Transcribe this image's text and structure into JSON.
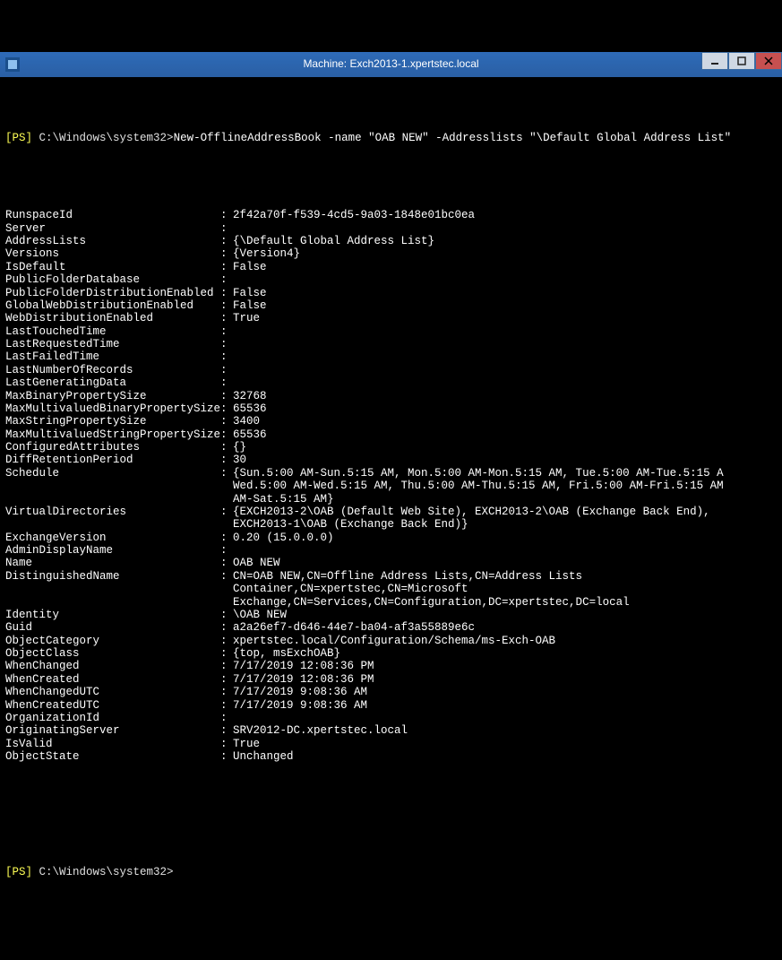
{
  "window": {
    "title": "Machine: Exch2013-1.xpertstec.local"
  },
  "prompt1": {
    "ps": "[PS]",
    "path": "C:\\Windows\\system32>",
    "command": "New-OfflineAddressBook -name \"OAB NEW\" -Addresslists \"\\Default Global Address List\""
  },
  "output": [
    {
      "k": "RunspaceId",
      "v": "2f42a70f-f539-4cd5-9a03-1848e01bc0ea"
    },
    {
      "k": "Server",
      "v": ""
    },
    {
      "k": "AddressLists",
      "v": "{\\Default Global Address List}"
    },
    {
      "k": "Versions",
      "v": "{Version4}"
    },
    {
      "k": "IsDefault",
      "v": "False"
    },
    {
      "k": "PublicFolderDatabase",
      "v": ""
    },
    {
      "k": "PublicFolderDistributionEnabled",
      "v": "False"
    },
    {
      "k": "GlobalWebDistributionEnabled",
      "v": "False"
    },
    {
      "k": "WebDistributionEnabled",
      "v": "True"
    },
    {
      "k": "LastTouchedTime",
      "v": ""
    },
    {
      "k": "LastRequestedTime",
      "v": ""
    },
    {
      "k": "LastFailedTime",
      "v": ""
    },
    {
      "k": "LastNumberOfRecords",
      "v": ""
    },
    {
      "k": "LastGeneratingData",
      "v": ""
    },
    {
      "k": "MaxBinaryPropertySize",
      "v": "32768"
    },
    {
      "k": "MaxMultivaluedBinaryPropertySize",
      "v": "65536"
    },
    {
      "k": "MaxStringPropertySize",
      "v": "3400"
    },
    {
      "k": "MaxMultivaluedStringPropertySize",
      "v": "65536"
    },
    {
      "k": "ConfiguredAttributes",
      "v": "{}"
    },
    {
      "k": "DiffRetentionPeriod",
      "v": "30"
    },
    {
      "k": "Schedule",
      "v": "{Sun.5:00 AM-Sun.5:15 AM, Mon.5:00 AM-Mon.5:15 AM, Tue.5:00 AM-Tue.5:15 A",
      "cont": [
        "Wed.5:00 AM-Wed.5:15 AM, Thu.5:00 AM-Thu.5:15 AM, Fri.5:00 AM-Fri.5:15 AM",
        "AM-Sat.5:15 AM}"
      ]
    },
    {
      "k": "VirtualDirectories",
      "v": "{EXCH2013-2\\OAB (Default Web Site), EXCH2013-2\\OAB (Exchange Back End),",
      "cont": [
        "EXCH2013-1\\OAB (Exchange Back End)}"
      ]
    },
    {
      "k": "ExchangeVersion",
      "v": "0.20 (15.0.0.0)"
    },
    {
      "k": "AdminDisplayName",
      "v": ""
    },
    {
      "k": "Name",
      "v": "OAB NEW"
    },
    {
      "k": "DistinguishedName",
      "v": "CN=OAB NEW,CN=Offline Address Lists,CN=Address Lists",
      "cont": [
        "Container,CN=xpertstec,CN=Microsoft",
        "Exchange,CN=Services,CN=Configuration,DC=xpertstec,DC=local"
      ]
    },
    {
      "k": "Identity",
      "v": "\\OAB NEW"
    },
    {
      "k": "Guid",
      "v": "a2a26ef7-d646-44e7-ba04-af3a55889e6c"
    },
    {
      "k": "ObjectCategory",
      "v": "xpertstec.local/Configuration/Schema/ms-Exch-OAB"
    },
    {
      "k": "ObjectClass",
      "v": "{top, msExchOAB}"
    },
    {
      "k": "WhenChanged",
      "v": "7/17/2019 12:08:36 PM"
    },
    {
      "k": "WhenCreated",
      "v": "7/17/2019 12:08:36 PM"
    },
    {
      "k": "WhenChangedUTC",
      "v": "7/17/2019 9:08:36 AM"
    },
    {
      "k": "WhenCreatedUTC",
      "v": "7/17/2019 9:08:36 AM"
    },
    {
      "k": "OrganizationId",
      "v": ""
    },
    {
      "k": "OriginatingServer",
      "v": "SRV2012-DC.xpertstec.local"
    },
    {
      "k": "IsValid",
      "v": "True"
    },
    {
      "k": "ObjectState",
      "v": "Unchanged"
    }
  ],
  "prompt2": {
    "ps": "[PS]",
    "path": "C:\\Windows\\system32>"
  }
}
